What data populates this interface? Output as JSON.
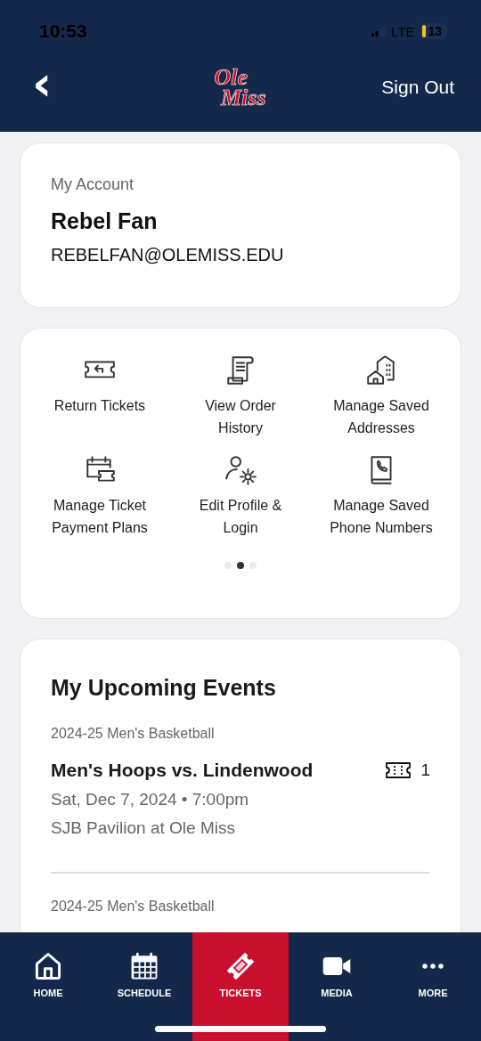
{
  "status_bar": {
    "time": "10:53",
    "network": "LTE",
    "battery": "13"
  },
  "header": {
    "back": "‹",
    "logo_top": "Ole",
    "logo_bottom": "Miss",
    "action": "Sign Out"
  },
  "account": {
    "heading": "My Account",
    "name": "Rebel Fan",
    "email": "REBELFAN@OLEMISS.EDU"
  },
  "actions": [
    {
      "label": "Return Tickets"
    },
    {
      "label": "View Order History"
    },
    {
      "label": "Manage Saved Addresses"
    },
    {
      "label": "Manage Ticket Payment Plans"
    },
    {
      "label": "Edit Profile & Login"
    },
    {
      "label": "Manage Saved Phone Numbers"
    }
  ],
  "pager": [
    {
      "selected": false
    },
    {
      "selected": true
    },
    {
      "selected": false
    }
  ],
  "events": {
    "title": "My Upcoming Events",
    "items": [
      {
        "category": "2024-25 Men's Basketball",
        "name": "Men's Hoops vs. Lindenwood",
        "ticket_count": "1",
        "date": "Sat, Dec 7, 2024 • 7:00pm",
        "venue": "SJB Pavilion at Ole Miss"
      },
      {
        "category": "2024-25 Men's Basketball"
      }
    ]
  },
  "tabs": [
    {
      "label": "HOME",
      "selected": false
    },
    {
      "label": "SCHEDULE",
      "selected": false
    },
    {
      "label": "TICKETS",
      "selected": true
    },
    {
      "label": "MEDIA",
      "selected": false
    },
    {
      "label": "MORE",
      "selected": false
    }
  ]
}
